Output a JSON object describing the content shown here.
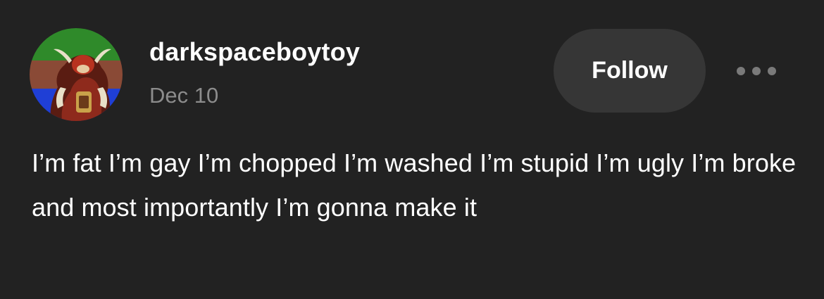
{
  "post": {
    "username": "darkspaceboytoy",
    "date": "Dec 10",
    "follow_label": "Follow",
    "more_icon": "more-horizontal-icon",
    "body_text": "I’m fat I’m gay I’m chopped I’m washed I’m stupid I’m ugly I’m broke and most importantly I’m gonna make it"
  },
  "avatar": {
    "icon": "avatar-image",
    "stripe_colors": [
      "#2f8a2a",
      "#8a4a36",
      "#1f3fd6"
    ]
  },
  "colors": {
    "background": "#222222",
    "button_background": "#363636",
    "muted_text": "#8c8c8c",
    "text": "#ffffff"
  }
}
